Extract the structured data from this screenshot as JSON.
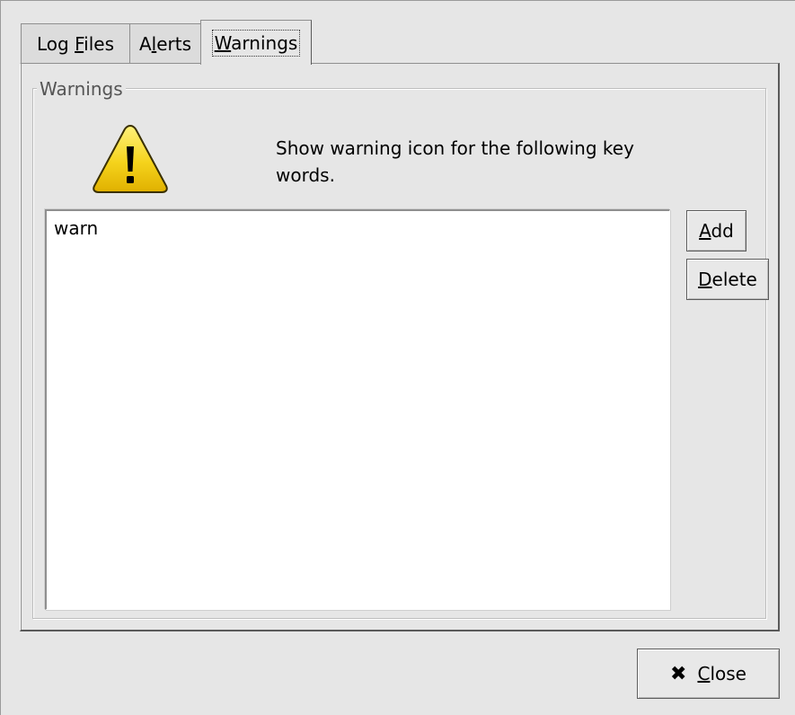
{
  "tabs": [
    {
      "pre": "Log ",
      "ul": "F",
      "post": "iles",
      "active": false
    },
    {
      "pre": "A",
      "ul": "l",
      "post": "erts",
      "active": false
    },
    {
      "pre": "",
      "ul": "W",
      "post": "arnings",
      "active": true
    }
  ],
  "frame": {
    "label": "Warnings"
  },
  "description": "Show warning icon for the following key words.",
  "warning_icon": "warning-triangle-icon",
  "keywords": [
    "warn"
  ],
  "buttons": {
    "add": {
      "ul": "A",
      "rest": "dd"
    },
    "delete": {
      "ul": "D",
      "rest": "elete"
    },
    "close": {
      "icon": "✖",
      "ul": "C",
      "rest": "lose"
    }
  },
  "colors": {
    "background": "#e6e6e6",
    "warning_yellow": "#f5d31c"
  }
}
